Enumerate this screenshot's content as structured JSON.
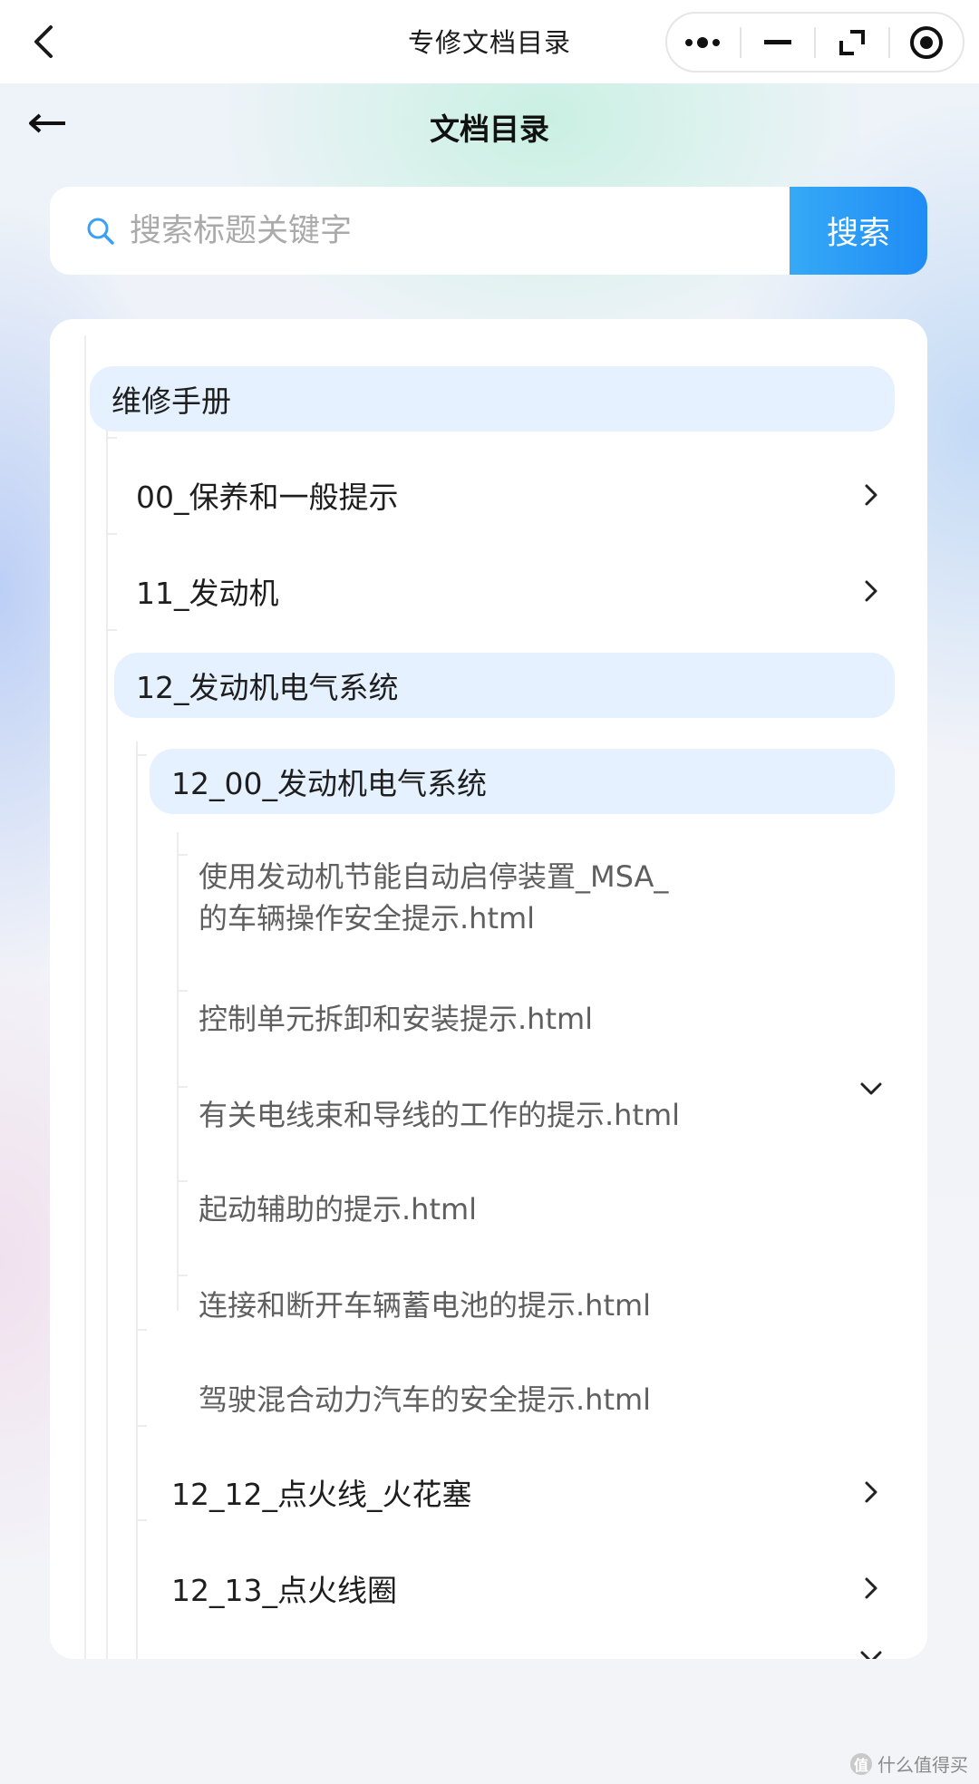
{
  "topbar": {
    "title": "专修文档目录"
  },
  "header": {
    "title": "文档目录"
  },
  "search": {
    "placeholder": "搜索标题关键字",
    "button_label": "搜索"
  },
  "tree": {
    "root": "维修手册",
    "section_00": "00_保养和一般提示",
    "section_11": "11_发动机",
    "section_12": "12_发动机电气系统",
    "section_12_00": "12_00_发动机电气系统",
    "docs": [
      "使用发动机节能自动启停装置_MSA_",
      "的车辆操作安全提示.html",
      "控制单元拆卸和安装提示.html",
      "有关电线束和导线的工作的提示.html",
      "起动辅助的提示.html",
      "连接和断开车辆蓄电池的提示.html",
      "驾驶混合动力汽车的安全提示.html"
    ],
    "section_12_12": "12_12_点火线_火花塞",
    "section_12_13": "12_13_点火线圈"
  },
  "watermark": {
    "text": "什么值得买",
    "logo": "值"
  },
  "colors": {
    "accent": "#1f8cf5",
    "highlight_row": "#e5f1ff"
  },
  "icons": [
    "back-chevron-icon",
    "more-dots-icon",
    "minimize-icon",
    "restore-icon",
    "target-icon",
    "back-arrow-icon",
    "search-icon",
    "chevron-right-icon",
    "chevron-down-icon"
  ]
}
